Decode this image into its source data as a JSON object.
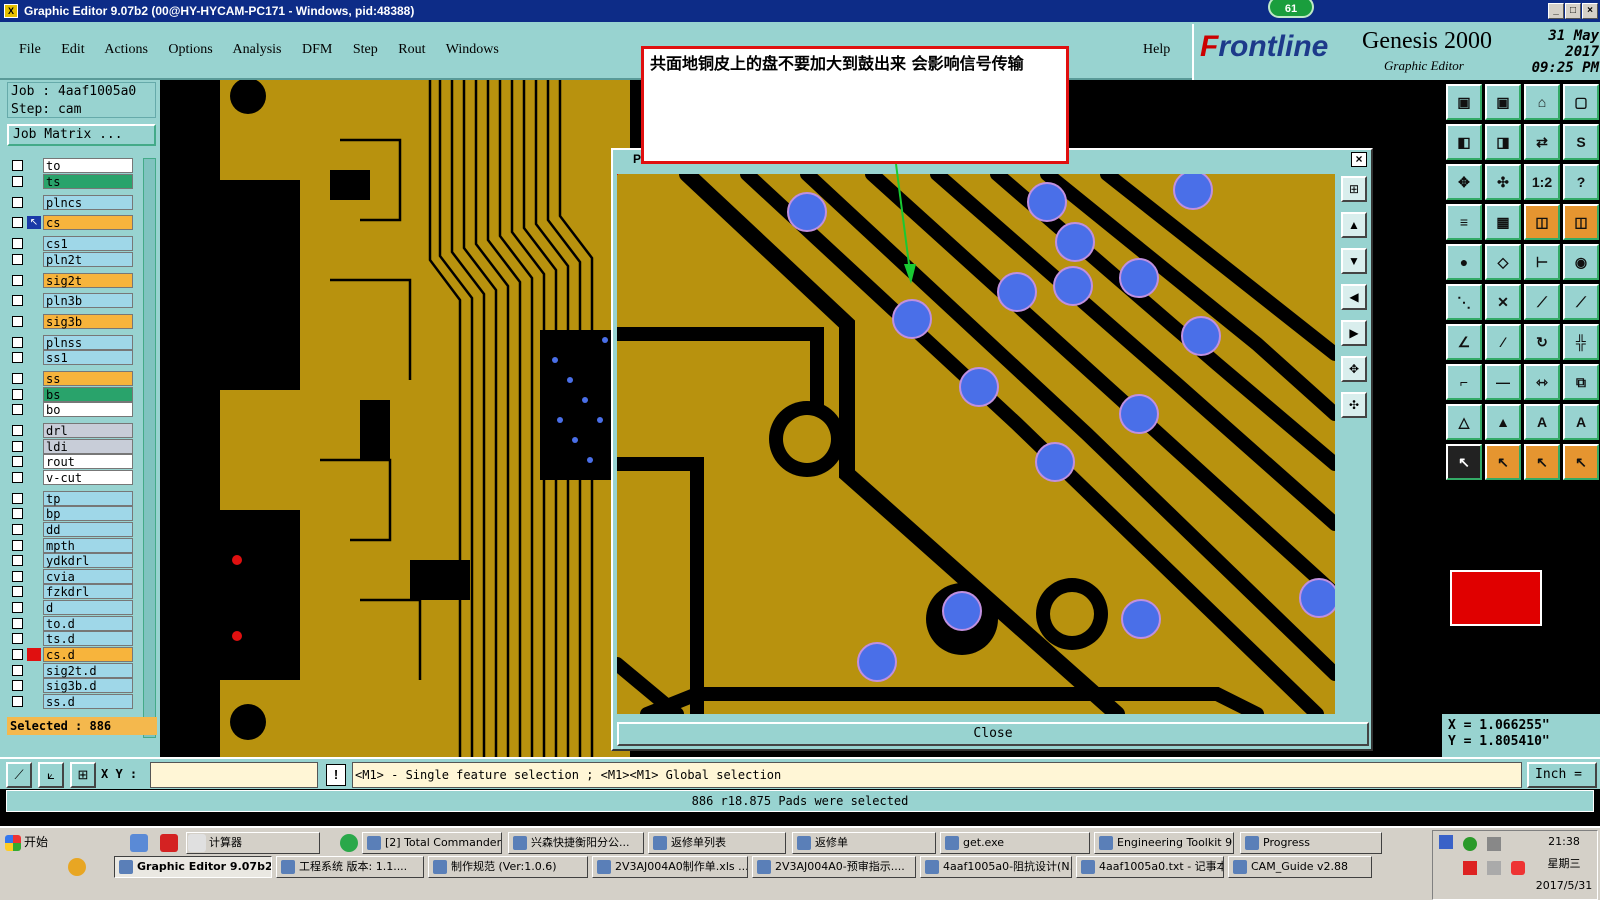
{
  "window": {
    "title": "Graphic Editor 9.07b2 (00@HY-HYCAM-PC171 - Windows, pid:48388)",
    "app_icon": "X",
    "badge": "61",
    "min": "_",
    "max": "□",
    "close": "×"
  },
  "menu": {
    "items": [
      "File",
      "Edit",
      "Actions",
      "Options",
      "Analysis",
      "DFM",
      "Step",
      "Rout",
      "Windows"
    ],
    "help": "Help"
  },
  "brand": {
    "logo_a": "F",
    "logo_b": "rontline",
    "product": "Genesis 2000",
    "subtitle": "Graphic Editor",
    "date": "31 May 2017",
    "time": "09:25 PM"
  },
  "job": {
    "job_line": "Job : 4aaf1005a0",
    "step_line": "Step: cam",
    "matrix_button": "Job Matrix ...",
    "selected": "Selected : 886"
  },
  "layers": [
    {
      "name": "to",
      "style": "c1"
    },
    {
      "name": "ts",
      "style": "c2"
    },
    {
      "name": "plncs",
      "style": "c4"
    },
    {
      "name": "cs",
      "style": "c3"
    },
    {
      "name": "cs1",
      "style": "c4"
    },
    {
      "name": "pln2t",
      "style": "c4"
    },
    {
      "name": "sig2t",
      "style": "c3"
    },
    {
      "name": "pln3b",
      "style": "c4"
    },
    {
      "name": "sig3b",
      "style": "c3"
    },
    {
      "name": "plnss",
      "style": "c4"
    },
    {
      "name": "ss1",
      "style": "c4"
    },
    {
      "name": "ss",
      "style": "c3"
    },
    {
      "name": "bs",
      "style": "c2"
    },
    {
      "name": "bo",
      "style": "c1"
    },
    {
      "name": "drl",
      "style": "c5"
    },
    {
      "name": "ldi",
      "style": "c5"
    },
    {
      "name": "rout",
      "style": "c1"
    },
    {
      "name": "v-cut",
      "style": "c1"
    },
    {
      "name": "tp",
      "style": "c6"
    },
    {
      "name": "bp",
      "style": "c6"
    },
    {
      "name": "dd",
      "style": "c6"
    },
    {
      "name": "mpth",
      "style": "c6"
    },
    {
      "name": "ydkdrl",
      "style": "c6"
    },
    {
      "name": "cvia",
      "style": "c6"
    },
    {
      "name": "fzkdrl",
      "style": "c6"
    },
    {
      "name": "d",
      "style": "c6"
    },
    {
      "name": "to.d",
      "style": "c6"
    },
    {
      "name": "ts.d",
      "style": "c6"
    },
    {
      "name": "cs.d",
      "style": "c3"
    },
    {
      "name": "sig2t.d",
      "style": "c6"
    },
    {
      "name": "sig3b.d",
      "style": "c6"
    },
    {
      "name": "ss.d",
      "style": "c6"
    }
  ],
  "popup": {
    "title": "Pi",
    "close_label": "Close"
  },
  "annotation": {
    "text": "共面地铜皮上的盘不要加大到鼓出来 会影响信号传输"
  },
  "coords": {
    "x": "X = 1.066255\"",
    "y": "Y = 1.805410\""
  },
  "command": {
    "xy_label": "X Y :",
    "xy_value": "",
    "excl": "!",
    "hint": "<M1> - Single feature selection ; <M1><M1> Global selection",
    "units": "Inch ="
  },
  "status": "886 r18.875 Pads were selected",
  "taskbar": {
    "start": "开始",
    "row1": [
      "计算器",
      "[2] Total Commander ...",
      "兴森快捷衡阳分公...",
      "返修单列表",
      "返修单",
      "get.exe",
      "Engineering Toolkit 9....",
      "Progress"
    ],
    "row2": [
      "Graphic Editor 9.07b2...",
      "工程系统  版本: 1.1....",
      "制作规范 (Ver:1.0.6)",
      "2V3AJ004A0制作单.xls ...",
      "2V3AJ004A0-预审指示....",
      "4aaf1005a0-阻抗设计(N...",
      "4aaf1005a0.txt - 记事本",
      "CAM_Guide v2.88"
    ],
    "time": "21:38",
    "weekday": "星期三",
    "date": "2017/5/31"
  },
  "colors": {
    "panel": "#98d3d0",
    "copper": "#b8920e",
    "pad": "#4a6fe8",
    "annotation_border": "#e01010",
    "arrow": "#19c933"
  }
}
